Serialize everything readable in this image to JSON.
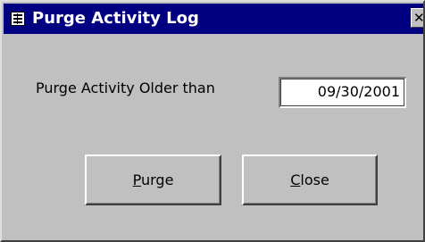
{
  "window": {
    "title": "Purge Activity Log",
    "close_glyph": "✕",
    "app_icon": "form-icon"
  },
  "form": {
    "label": "Purge Activity Older than",
    "date_value": "09/30/2001"
  },
  "buttons": {
    "purge": {
      "mnemonic": "P",
      "rest": "urge"
    },
    "close": {
      "mnemonic": "C",
      "rest": "lose"
    }
  },
  "colors": {
    "titlebar": "#000080",
    "window_bg": "#c0c0c0"
  }
}
